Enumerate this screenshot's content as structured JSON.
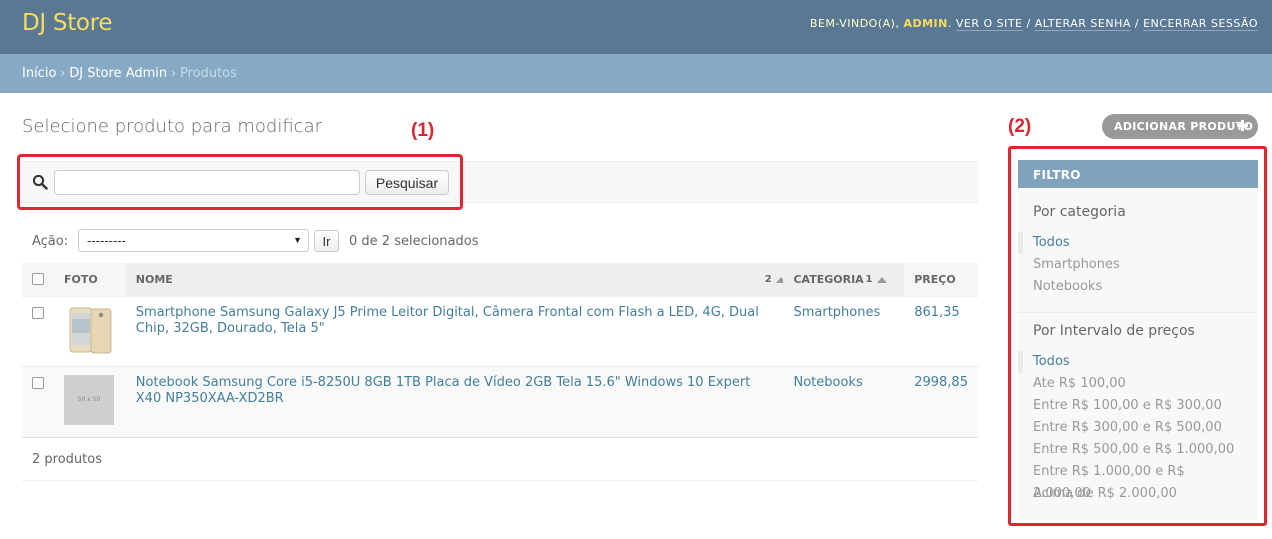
{
  "header": {
    "brand": "DJ Store",
    "welcome": "Bem-vindo(a),",
    "username": "admin",
    "links": [
      "Ver o site",
      "Alterar senha",
      "Encerrar sessão"
    ]
  },
  "breadcrumbs": {
    "items": [
      "Início",
      "DJ Store Admin",
      "Produtos"
    ]
  },
  "page_title": "Selecione produto para modificar",
  "annotations": [
    "(1)",
    "(2)"
  ],
  "search": {
    "placeholder": "",
    "value": "",
    "button_label": "Pesquisar"
  },
  "actions": {
    "label": "Ação:",
    "selected_option": "---------",
    "go_label": "Ir",
    "counter": "0 de 2 selecionados"
  },
  "table": {
    "columns": [
      "Foto",
      "Nome",
      "Categoria",
      "Preço"
    ],
    "sort": {
      "name_priority": "2",
      "category_priority": "1"
    },
    "rows": [
      {
        "name": "Smartphone Samsung Galaxy J5 Prime Leitor Digital, Câmera Frontal com Flash a LED, 4G, Dual Chip, 32GB, Dourado, Tela 5\"",
        "category": "Smartphones",
        "price": "861,35",
        "photo": "phone-photo"
      },
      {
        "name": "Notebook Samsung Core i5-8250U 8GB 1TB Placa de Vídeo 2GB Tela 15.6\" Windows 10 Expert X40 NP350XAA-XD2BR",
        "category": "Notebooks",
        "price": "2998,85",
        "photo": "placeholder-photo",
        "photo_text": "50 x 50"
      }
    ]
  },
  "paginator": "2 produtos",
  "add_button": "Adicionar produto",
  "filter": {
    "title": "Filtro",
    "groups": [
      {
        "heading": "Por categoria",
        "options": [
          "Todos",
          "Smartphones",
          "Notebooks"
        ],
        "selected": 0
      },
      {
        "heading": "Por Intervalo de preços",
        "options": [
          "Todos",
          "Ate R$ 100,00",
          "Entre R$ 100,00 e R$ 300,00",
          "Entre R$ 300,00 e R$ 500,00",
          "Entre R$ 500,00 e R$ 1.000,00",
          "Entre R$ 1.000,00 e R$ 2.000,00",
          "Acima de R$ 2.000,00"
        ],
        "selected": 0
      }
    ]
  },
  "colors": {
    "header_bg": "#5a7894",
    "breadcrumb_bg": "#87a9c3",
    "brand": "#f5dd5d",
    "link": "#447e9b",
    "annotation": "#e0272f"
  }
}
